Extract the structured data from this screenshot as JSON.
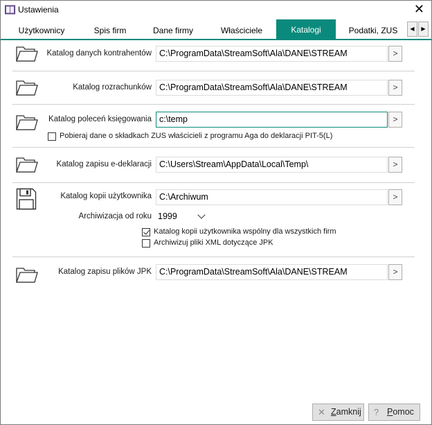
{
  "window": {
    "title": "Ustawienia",
    "close_glyph": "✕"
  },
  "tabs": [
    {
      "label": "Użytkownicy"
    },
    {
      "label": "Spis firm"
    },
    {
      "label": "Dane firmy"
    },
    {
      "label": "Właściciele"
    },
    {
      "label": "Katalogi",
      "active": true
    },
    {
      "label": "Podatki, ZUS"
    }
  ],
  "tab_scroll": {
    "left": "◀",
    "right": "▶"
  },
  "catalogs": {
    "kontrahenci": {
      "label": "Katalog danych kontrahentów",
      "value": "C:\\ProgramData\\StreamSoft\\Ala\\DANE\\STREAM"
    },
    "rozrachunki": {
      "label": "Katalog rozrachunków",
      "value": "C:\\ProgramData\\StreamSoft\\Ala\\DANE\\STREAM"
    },
    "polecenia": {
      "label": "Katalog poleceń księgowania",
      "value": "c:\\temp"
    },
    "zus_checkbox": {
      "label": "Pobieraj dane o składkach ZUS właścicieli z programu Aga do deklaracji PIT-5(L)",
      "checked": false
    },
    "edeklaracje": {
      "label": "Katalog zapisu e-deklaracji",
      "value": "C:\\Users\\Stream\\AppData\\Local\\Temp\\"
    },
    "kopie": {
      "label": "Katalog kopii użytkownika",
      "value": "C:\\Archiwum"
    },
    "archiwizacja": {
      "label": "Archiwizacja od roku",
      "value": "1999"
    },
    "wspolny_checkbox": {
      "label": "Katalog kopii użytkownika wspólny dla wszystkich firm",
      "checked": true
    },
    "xml_checkbox": {
      "label": "Archiwizuj pliki XML dotyczące JPK",
      "checked": false
    },
    "jpk": {
      "label": "Katalog zapisu plików JPK",
      "value": "C:\\ProgramData\\StreamSoft\\Ala\\DANE\\STREAM"
    }
  },
  "browse_glyph": ">",
  "footer": {
    "close": {
      "icon": "✕",
      "label_ul": "Z",
      "label_rest": "amknij"
    },
    "help": {
      "icon": "?",
      "label_ul": "P",
      "label_rest": "omoc"
    }
  },
  "colors": {
    "accent": "#0a8a7c"
  }
}
